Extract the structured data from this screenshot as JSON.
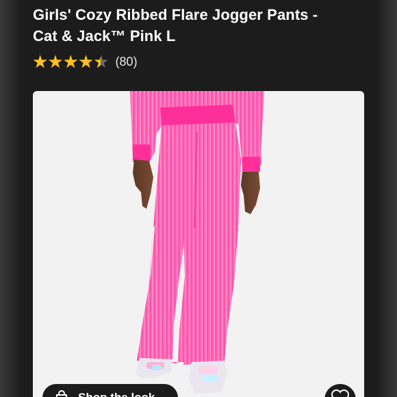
{
  "product": {
    "title_line1": "Girls' Cozy Ribbed Flare Jogger Pants -",
    "title_line2": "Cat & Jack™ Pink L",
    "rating": 4.5,
    "rating_max": 5,
    "review_count": "(80)"
  },
  "actions": {
    "shop_label": "Shop the look",
    "favorite_icon": "heart-icon",
    "shop_icon": "shopping-bag-icon"
  },
  "colors": {
    "background": "#1c1c1c",
    "star": "#ffc21f",
    "product_pink": "#ff5fb0",
    "waistband": "#ff2f9a"
  }
}
